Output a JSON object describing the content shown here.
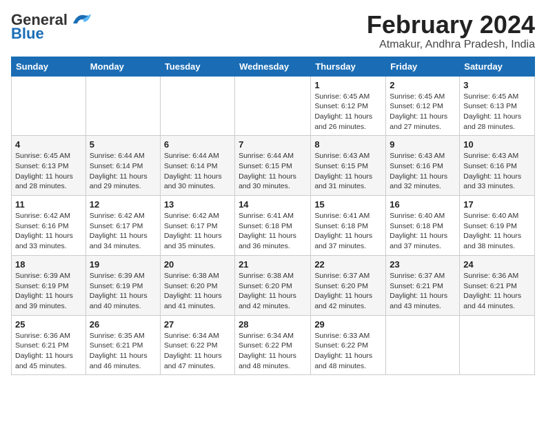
{
  "logo": {
    "text1": "General",
    "text2": "Blue"
  },
  "header": {
    "month": "February 2024",
    "location": "Atmakur, Andhra Pradesh, India"
  },
  "days_of_week": [
    "Sunday",
    "Monday",
    "Tuesday",
    "Wednesday",
    "Thursday",
    "Friday",
    "Saturday"
  ],
  "weeks": [
    [
      {
        "day": "",
        "info": ""
      },
      {
        "day": "",
        "info": ""
      },
      {
        "day": "",
        "info": ""
      },
      {
        "day": "",
        "info": ""
      },
      {
        "day": "1",
        "info": "Sunrise: 6:45 AM\nSunset: 6:12 PM\nDaylight: 11 hours\nand 26 minutes."
      },
      {
        "day": "2",
        "info": "Sunrise: 6:45 AM\nSunset: 6:12 PM\nDaylight: 11 hours\nand 27 minutes."
      },
      {
        "day": "3",
        "info": "Sunrise: 6:45 AM\nSunset: 6:13 PM\nDaylight: 11 hours\nand 28 minutes."
      }
    ],
    [
      {
        "day": "4",
        "info": "Sunrise: 6:45 AM\nSunset: 6:13 PM\nDaylight: 11 hours\nand 28 minutes."
      },
      {
        "day": "5",
        "info": "Sunrise: 6:44 AM\nSunset: 6:14 PM\nDaylight: 11 hours\nand 29 minutes."
      },
      {
        "day": "6",
        "info": "Sunrise: 6:44 AM\nSunset: 6:14 PM\nDaylight: 11 hours\nand 30 minutes."
      },
      {
        "day": "7",
        "info": "Sunrise: 6:44 AM\nSunset: 6:15 PM\nDaylight: 11 hours\nand 30 minutes."
      },
      {
        "day": "8",
        "info": "Sunrise: 6:43 AM\nSunset: 6:15 PM\nDaylight: 11 hours\nand 31 minutes."
      },
      {
        "day": "9",
        "info": "Sunrise: 6:43 AM\nSunset: 6:16 PM\nDaylight: 11 hours\nand 32 minutes."
      },
      {
        "day": "10",
        "info": "Sunrise: 6:43 AM\nSunset: 6:16 PM\nDaylight: 11 hours\nand 33 minutes."
      }
    ],
    [
      {
        "day": "11",
        "info": "Sunrise: 6:42 AM\nSunset: 6:16 PM\nDaylight: 11 hours\nand 33 minutes."
      },
      {
        "day": "12",
        "info": "Sunrise: 6:42 AM\nSunset: 6:17 PM\nDaylight: 11 hours\nand 34 minutes."
      },
      {
        "day": "13",
        "info": "Sunrise: 6:42 AM\nSunset: 6:17 PM\nDaylight: 11 hours\nand 35 minutes."
      },
      {
        "day": "14",
        "info": "Sunrise: 6:41 AM\nSunset: 6:18 PM\nDaylight: 11 hours\nand 36 minutes."
      },
      {
        "day": "15",
        "info": "Sunrise: 6:41 AM\nSunset: 6:18 PM\nDaylight: 11 hours\nand 37 minutes."
      },
      {
        "day": "16",
        "info": "Sunrise: 6:40 AM\nSunset: 6:18 PM\nDaylight: 11 hours\nand 37 minutes."
      },
      {
        "day": "17",
        "info": "Sunrise: 6:40 AM\nSunset: 6:19 PM\nDaylight: 11 hours\nand 38 minutes."
      }
    ],
    [
      {
        "day": "18",
        "info": "Sunrise: 6:39 AM\nSunset: 6:19 PM\nDaylight: 11 hours\nand 39 minutes."
      },
      {
        "day": "19",
        "info": "Sunrise: 6:39 AM\nSunset: 6:19 PM\nDaylight: 11 hours\nand 40 minutes."
      },
      {
        "day": "20",
        "info": "Sunrise: 6:38 AM\nSunset: 6:20 PM\nDaylight: 11 hours\nand 41 minutes."
      },
      {
        "day": "21",
        "info": "Sunrise: 6:38 AM\nSunset: 6:20 PM\nDaylight: 11 hours\nand 42 minutes."
      },
      {
        "day": "22",
        "info": "Sunrise: 6:37 AM\nSunset: 6:20 PM\nDaylight: 11 hours\nand 42 minutes."
      },
      {
        "day": "23",
        "info": "Sunrise: 6:37 AM\nSunset: 6:21 PM\nDaylight: 11 hours\nand 43 minutes."
      },
      {
        "day": "24",
        "info": "Sunrise: 6:36 AM\nSunset: 6:21 PM\nDaylight: 11 hours\nand 44 minutes."
      }
    ],
    [
      {
        "day": "25",
        "info": "Sunrise: 6:36 AM\nSunset: 6:21 PM\nDaylight: 11 hours\nand 45 minutes."
      },
      {
        "day": "26",
        "info": "Sunrise: 6:35 AM\nSunset: 6:21 PM\nDaylight: 11 hours\nand 46 minutes."
      },
      {
        "day": "27",
        "info": "Sunrise: 6:34 AM\nSunset: 6:22 PM\nDaylight: 11 hours\nand 47 minutes."
      },
      {
        "day": "28",
        "info": "Sunrise: 6:34 AM\nSunset: 6:22 PM\nDaylight: 11 hours\nand 48 minutes."
      },
      {
        "day": "29",
        "info": "Sunrise: 6:33 AM\nSunset: 6:22 PM\nDaylight: 11 hours\nand 48 minutes."
      },
      {
        "day": "",
        "info": ""
      },
      {
        "day": "",
        "info": ""
      }
    ]
  ]
}
